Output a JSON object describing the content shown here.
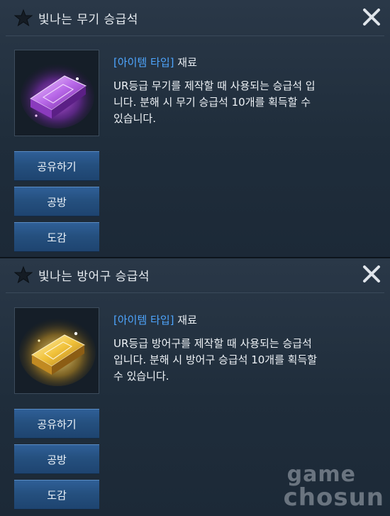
{
  "panels": [
    {
      "title": "빛나는 무기 승급석",
      "type_label": "[아이템 타입]",
      "type_value": "재료",
      "description_lines": [
        "UR등급 무기를 제작할 때 사용되는 승급석 입",
        "니다. 분해 시 무기 승급석 10개를 획득할 수",
        "있습니다."
      ],
      "item_icon": "purple-gem-ingot-icon",
      "buttons": {
        "share": "공유하기",
        "attack_defense": "공방",
        "codex": "도감"
      }
    },
    {
      "title": "빛나는 방어구 승급석",
      "type_label": "[아이템 타입]",
      "type_value": "재료",
      "description_lines": [
        "UR등급 방어구를 제작할 때 사용되는 승급석",
        "입니다. 분해 시 방어구 승급석 10개를 획득할",
        "수 있습니다."
      ],
      "item_icon": "gold-gem-ingot-icon",
      "buttons": {
        "share": "공유하기",
        "attack_defense": "공방",
        "codex": "도감"
      }
    }
  ],
  "watermark": {
    "line1": "game",
    "line2": "chosun"
  },
  "colors": {
    "panel_bg": "#24323f",
    "type_label": "#4ea6ff",
    "button": "#27527f",
    "text": "#eef2f6"
  }
}
